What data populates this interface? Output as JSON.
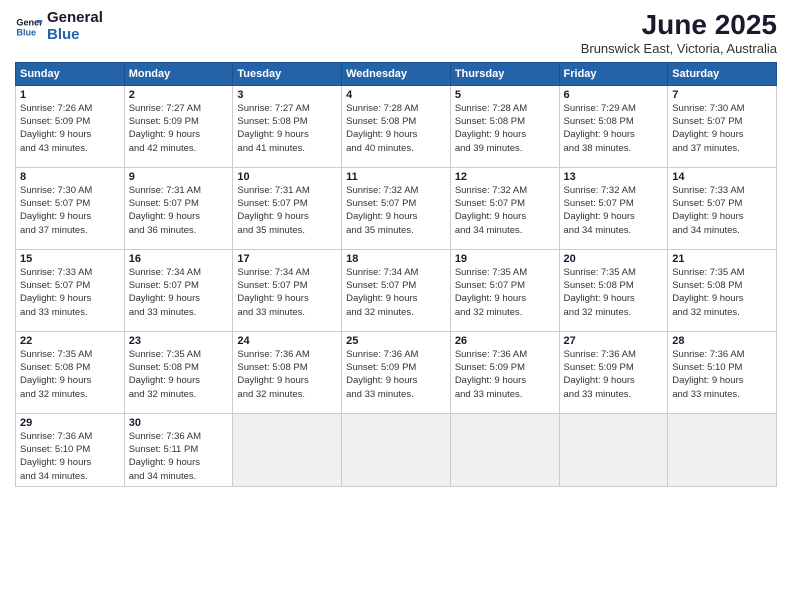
{
  "logo": {
    "line1": "General",
    "line2": "Blue"
  },
  "title": "June 2025",
  "location": "Brunswick East, Victoria, Australia",
  "weekdays": [
    "Sunday",
    "Monday",
    "Tuesday",
    "Wednesday",
    "Thursday",
    "Friday",
    "Saturday"
  ],
  "weeks": [
    [
      {
        "day": "1",
        "sunrise": "7:26 AM",
        "sunset": "5:09 PM",
        "daylight": "9 hours and 43 minutes."
      },
      {
        "day": "2",
        "sunrise": "7:27 AM",
        "sunset": "5:09 PM",
        "daylight": "9 hours and 42 minutes."
      },
      {
        "day": "3",
        "sunrise": "7:27 AM",
        "sunset": "5:08 PM",
        "daylight": "9 hours and 41 minutes."
      },
      {
        "day": "4",
        "sunrise": "7:28 AM",
        "sunset": "5:08 PM",
        "daylight": "9 hours and 40 minutes."
      },
      {
        "day": "5",
        "sunrise": "7:28 AM",
        "sunset": "5:08 PM",
        "daylight": "9 hours and 39 minutes."
      },
      {
        "day": "6",
        "sunrise": "7:29 AM",
        "sunset": "5:08 PM",
        "daylight": "9 hours and 38 minutes."
      },
      {
        "day": "7",
        "sunrise": "7:30 AM",
        "sunset": "5:07 PM",
        "daylight": "9 hours and 37 minutes."
      }
    ],
    [
      {
        "day": "8",
        "sunrise": "7:30 AM",
        "sunset": "5:07 PM",
        "daylight": "9 hours and 37 minutes."
      },
      {
        "day": "9",
        "sunrise": "7:31 AM",
        "sunset": "5:07 PM",
        "daylight": "9 hours and 36 minutes."
      },
      {
        "day": "10",
        "sunrise": "7:31 AM",
        "sunset": "5:07 PM",
        "daylight": "9 hours and 35 minutes."
      },
      {
        "day": "11",
        "sunrise": "7:32 AM",
        "sunset": "5:07 PM",
        "daylight": "9 hours and 35 minutes."
      },
      {
        "day": "12",
        "sunrise": "7:32 AM",
        "sunset": "5:07 PM",
        "daylight": "9 hours and 34 minutes."
      },
      {
        "day": "13",
        "sunrise": "7:32 AM",
        "sunset": "5:07 PM",
        "daylight": "9 hours and 34 minutes."
      },
      {
        "day": "14",
        "sunrise": "7:33 AM",
        "sunset": "5:07 PM",
        "daylight": "9 hours and 34 minutes."
      }
    ],
    [
      {
        "day": "15",
        "sunrise": "7:33 AM",
        "sunset": "5:07 PM",
        "daylight": "9 hours and 33 minutes."
      },
      {
        "day": "16",
        "sunrise": "7:34 AM",
        "sunset": "5:07 PM",
        "daylight": "9 hours and 33 minutes."
      },
      {
        "day": "17",
        "sunrise": "7:34 AM",
        "sunset": "5:07 PM",
        "daylight": "9 hours and 33 minutes."
      },
      {
        "day": "18",
        "sunrise": "7:34 AM",
        "sunset": "5:07 PM",
        "daylight": "9 hours and 32 minutes."
      },
      {
        "day": "19",
        "sunrise": "7:35 AM",
        "sunset": "5:07 PM",
        "daylight": "9 hours and 32 minutes."
      },
      {
        "day": "20",
        "sunrise": "7:35 AM",
        "sunset": "5:08 PM",
        "daylight": "9 hours and 32 minutes."
      },
      {
        "day": "21",
        "sunrise": "7:35 AM",
        "sunset": "5:08 PM",
        "daylight": "9 hours and 32 minutes."
      }
    ],
    [
      {
        "day": "22",
        "sunrise": "7:35 AM",
        "sunset": "5:08 PM",
        "daylight": "9 hours and 32 minutes."
      },
      {
        "day": "23",
        "sunrise": "7:35 AM",
        "sunset": "5:08 PM",
        "daylight": "9 hours and 32 minutes."
      },
      {
        "day": "24",
        "sunrise": "7:36 AM",
        "sunset": "5:08 PM",
        "daylight": "9 hours and 32 minutes."
      },
      {
        "day": "25",
        "sunrise": "7:36 AM",
        "sunset": "5:09 PM",
        "daylight": "9 hours and 33 minutes."
      },
      {
        "day": "26",
        "sunrise": "7:36 AM",
        "sunset": "5:09 PM",
        "daylight": "9 hours and 33 minutes."
      },
      {
        "day": "27",
        "sunrise": "7:36 AM",
        "sunset": "5:09 PM",
        "daylight": "9 hours and 33 minutes."
      },
      {
        "day": "28",
        "sunrise": "7:36 AM",
        "sunset": "5:10 PM",
        "daylight": "9 hours and 33 minutes."
      }
    ],
    [
      {
        "day": "29",
        "sunrise": "7:36 AM",
        "sunset": "5:10 PM",
        "daylight": "9 hours and 34 minutes."
      },
      {
        "day": "30",
        "sunrise": "7:36 AM",
        "sunset": "5:11 PM",
        "daylight": "9 hours and 34 minutes."
      },
      null,
      null,
      null,
      null,
      null
    ]
  ],
  "labels": {
    "sunrise": "Sunrise:",
    "sunset": "Sunset:",
    "daylight": "Daylight:"
  }
}
